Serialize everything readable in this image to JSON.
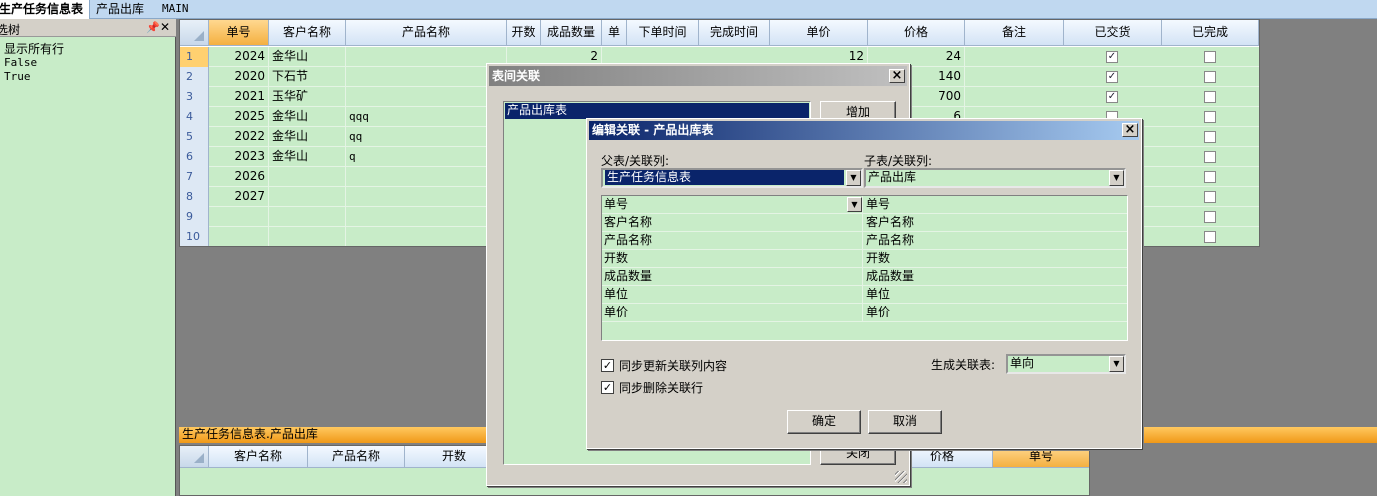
{
  "tabs": [
    {
      "label": "生产任务信息表",
      "active": true
    },
    {
      "label": "产品出库",
      "active": false
    },
    {
      "label": "MAIN",
      "active": false
    }
  ],
  "left_panel": {
    "title": "选树",
    "pin_icon": "pin-icon",
    "close_label": "✕",
    "lines": [
      "显示所有行",
      "False",
      "True"
    ]
  },
  "main_grid": {
    "columns": [
      "单号",
      "客户名称",
      "产品名称",
      "开数",
      "成品数量",
      "单",
      "下单时间",
      "完成时间",
      "单价",
      "价格",
      "备注",
      "已交货",
      "已完成"
    ],
    "selected_column": "单号",
    "rows": [
      {
        "n": "1",
        "id": "2024",
        "customer": "金华山",
        "product": "",
        "qty": "2",
        "unit_price": "12",
        "price": "24",
        "delivered": true,
        "done": false
      },
      {
        "n": "2",
        "id": "2020",
        "customer": "下石节",
        "product": "",
        "qty": "",
        "unit_price": "",
        "price": "140",
        "delivered": true,
        "done": false
      },
      {
        "n": "3",
        "id": "2021",
        "customer": "玉华矿",
        "product": "",
        "qty": "",
        "unit_price": "",
        "price": "700",
        "delivered": true,
        "done": false
      },
      {
        "n": "4",
        "id": "2025",
        "customer": "金华山",
        "product": "qqq",
        "qty": "",
        "unit_price": "",
        "price": "6",
        "delivered": false,
        "done": false
      },
      {
        "n": "5",
        "id": "2022",
        "customer": "金华山",
        "product": "qq",
        "qty": "",
        "unit_price": "",
        "price": "",
        "delivered": false,
        "done": false
      },
      {
        "n": "6",
        "id": "2023",
        "customer": "金华山",
        "product": "q",
        "qty": "",
        "unit_price": "",
        "price": "",
        "delivered": false,
        "done": false
      },
      {
        "n": "7",
        "id": "2026",
        "customer": "",
        "product": "",
        "qty": "",
        "unit_price": "",
        "price": "",
        "delivered": false,
        "done": false
      },
      {
        "n": "8",
        "id": "2027",
        "customer": "",
        "product": "",
        "qty": "",
        "unit_price": "",
        "price": "",
        "delivered": false,
        "done": false
      },
      {
        "n": "9",
        "id": "",
        "customer": "",
        "product": "",
        "qty": "",
        "unit_price": "",
        "price": "",
        "delivered": false,
        "done": false
      },
      {
        "n": "10",
        "id": "",
        "customer": "",
        "product": "",
        "qty": "",
        "unit_price": "",
        "price": "",
        "delivered": false,
        "done": false
      }
    ]
  },
  "sub_grid": {
    "caption": "生产任务信息表.产品出库",
    "columns": [
      "客户名称",
      "产品名称",
      "开数",
      "价格",
      "单号"
    ],
    "selected_column": "单号"
  },
  "dialog_relations": {
    "title": "表间关联",
    "list_items": [
      "产品出库表"
    ],
    "add_button": "增加",
    "close_button": "关闭"
  },
  "dialog_edit": {
    "title": "编辑关联 - 产品出库表",
    "parent_label": "父表/关联列:",
    "child_label": "子表/关联列:",
    "parent_table": "生产任务信息表",
    "child_table": "产品出库",
    "mappings": [
      {
        "parent": "单号",
        "child": "单号"
      },
      {
        "parent": "客户名称",
        "child": "客户名称"
      },
      {
        "parent": "产品名称",
        "child": "产品名称"
      },
      {
        "parent": "开数",
        "child": "开数"
      },
      {
        "parent": "成品数量",
        "child": "成品数量"
      },
      {
        "parent": "单位",
        "child": "单位"
      },
      {
        "parent": "单价",
        "child": "单价"
      }
    ],
    "sync_update_label": "同步更新关联列内容",
    "sync_update_checked": true,
    "sync_delete_label": "同步删除关联行",
    "sync_delete_checked": true,
    "generate_label": "生成关联表:",
    "generate_value": "单向",
    "ok_button": "确定",
    "cancel_button": "取消"
  }
}
